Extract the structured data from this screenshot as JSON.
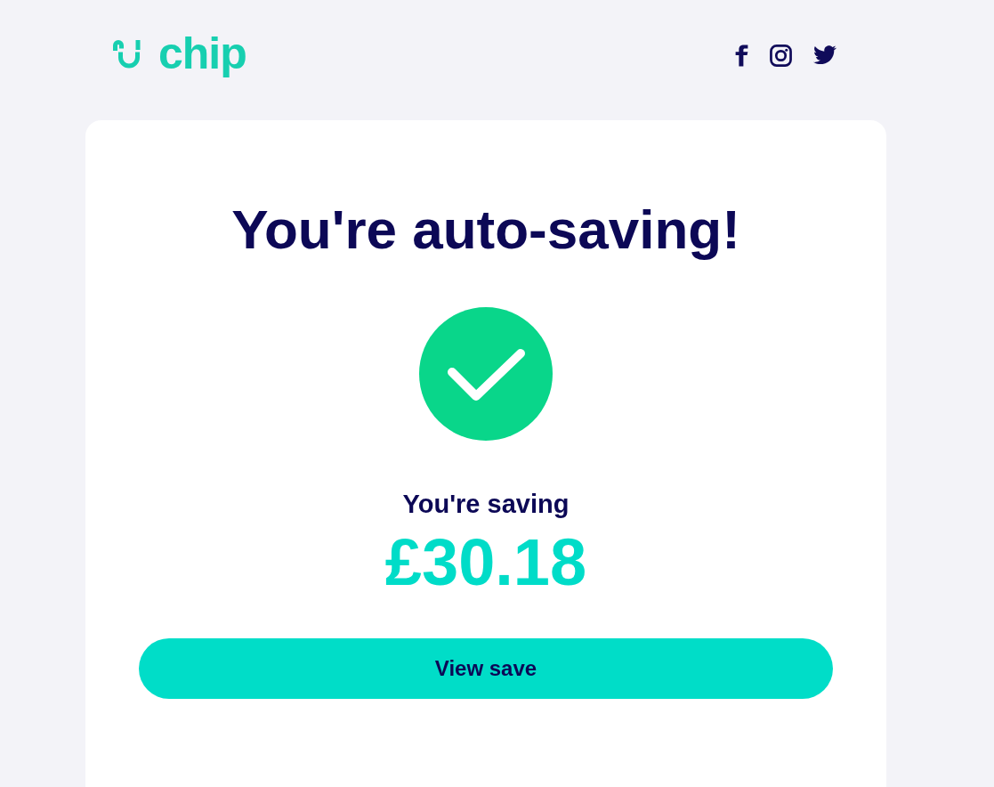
{
  "header": {
    "logo_text": "chip"
  },
  "card": {
    "title": "You're auto-saving!",
    "saving_label": "You're saving",
    "amount": "£30.18",
    "button_label": "View save"
  }
}
